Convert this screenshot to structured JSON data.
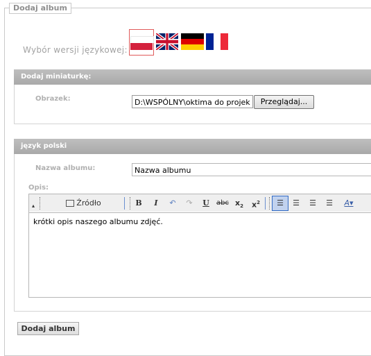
{
  "form": {
    "legend": "Dodaj album",
    "language_label": "Wybór wersji językowej:",
    "languages": [
      {
        "code": "pl",
        "name": "Polski",
        "selected": true
      },
      {
        "code": "en",
        "name": "English",
        "selected": false
      },
      {
        "code": "de",
        "name": "Deutsch",
        "selected": false
      },
      {
        "code": "fr",
        "name": "Français",
        "selected": false
      }
    ],
    "thumbnail_section": {
      "title": "Dodaj miniaturkę:",
      "image_label": "Obrazek:",
      "file_value": "D:\\WSPÓLNY\\oktima do projek",
      "browse_label": "Przeglądaj..."
    },
    "polish_section": {
      "title": "język polski",
      "album_name_label": "Nazwa albumu:",
      "album_name_value": "Nazwa albumu",
      "description_label": "Opis:"
    },
    "editor": {
      "source_label": "Źródło dokumentu",
      "content": "krótki opis naszego albumu zdjęć."
    },
    "submit_label": "Dodaj album"
  },
  "colors": {
    "panel_header": "#b4b4b4",
    "label": "#b0b0b0",
    "selected_flag_border": "#e05a5a"
  }
}
